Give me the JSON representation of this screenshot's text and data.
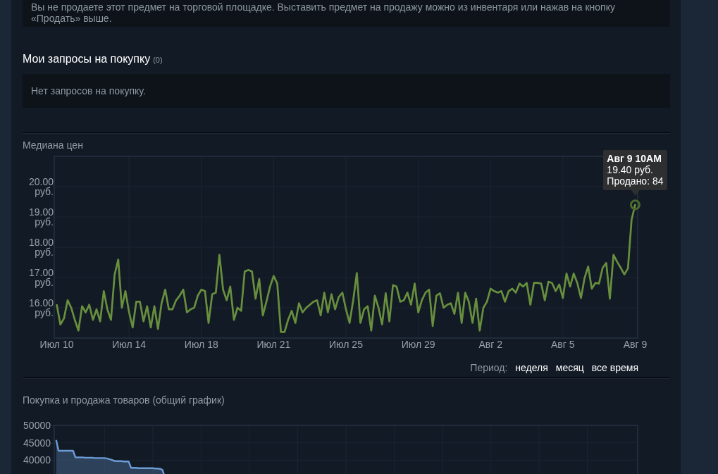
{
  "notice": {
    "text": "Вы не продаете этот предмет на торговой площадке. Выставить предмет на продажу можно из инвентаря или нажав на кнопку «Продать» выше."
  },
  "buy_orders": {
    "title": "Мои запросы на покупку",
    "count": "(0)",
    "empty_text": "Нет запросов на покупку."
  },
  "price_history": {
    "title": "Медиана цен",
    "chart_data": {
      "type": "line",
      "grid": true,
      "ylim": [
        15,
        21
      ],
      "yticks": [
        {
          "value": 20,
          "label": "20.00 руб."
        },
        {
          "value": 19,
          "label": "19.00 руб."
        },
        {
          "value": 18,
          "label": "18.00 руб."
        },
        {
          "value": 17,
          "label": "17.00 руб."
        },
        {
          "value": 16,
          "label": "16.00 руб."
        }
      ],
      "categories": [
        "Июл 10",
        null,
        null,
        null,
        null,
        null,
        null,
        null,
        null,
        null,
        null,
        null,
        null,
        null,
        null,
        null,
        null,
        null,
        null,
        null,
        "Июл 14",
        null,
        null,
        null,
        null,
        null,
        null,
        null,
        null,
        null,
        null,
        null,
        null,
        null,
        null,
        null,
        null,
        null,
        null,
        null,
        "Июл 18",
        null,
        null,
        null,
        null,
        null,
        null,
        null,
        null,
        null,
        null,
        null,
        null,
        null,
        null,
        null,
        null,
        null,
        null,
        null,
        "Июл 21",
        null,
        null,
        null,
        null,
        null,
        null,
        null,
        null,
        null,
        null,
        null,
        null,
        null,
        null,
        null,
        null,
        null,
        null,
        null,
        "Июл 25",
        null,
        null,
        null,
        null,
        null,
        null,
        null,
        null,
        null,
        null,
        null,
        null,
        null,
        null,
        null,
        null,
        null,
        null,
        null,
        "Июл 29",
        null,
        null,
        null,
        null,
        null,
        null,
        null,
        null,
        null,
        null,
        null,
        null,
        null,
        null,
        null,
        null,
        null,
        null,
        null,
        "Авг 2",
        null,
        null,
        null,
        null,
        null,
        null,
        null,
        null,
        null,
        null,
        null,
        null,
        null,
        null,
        null,
        null,
        null,
        null,
        null,
        "Авг 5",
        null,
        null,
        null,
        null,
        null,
        null,
        null,
        null,
        null,
        null,
        null,
        null,
        null,
        null,
        null,
        null,
        null,
        null,
        null,
        "Авг 9"
      ],
      "series": [
        {
          "color": "#688f3e",
          "values": [
            16.09,
            15.45,
            15.65,
            16.25,
            16.0,
            15.6,
            15.25,
            16.05,
            15.85,
            16.1,
            15.6,
            15.95,
            15.55,
            16.55,
            15.95,
            15.6,
            17.1,
            17.59,
            16.0,
            16.55,
            15.85,
            15.35,
            16.2,
            16.2,
            15.55,
            16.05,
            15.35,
            16.05,
            15.3,
            16.15,
            16.6,
            15.95,
            15.95,
            16.25,
            16.4,
            16.6,
            15.85,
            15.95,
            16.0,
            16.4,
            16.6,
            16.55,
            15.5,
            16.45,
            16.5,
            17.75,
            16.6,
            16.25,
            16.7,
            15.6,
            16.0,
            15.9,
            17.2,
            17.25,
            17.2,
            16.3,
            16.95,
            15.75,
            16.2,
            16.7,
            17.05,
            16.8,
            15.2,
            15.2,
            15.6,
            15.9,
            15.5,
            16.15,
            15.85,
            16.0,
            16.1,
            16.2,
            16.25,
            15.75,
            16.5,
            15.85,
            16.45,
            15.95,
            16.35,
            16.5,
            15.95,
            15.5,
            16.25,
            17.15,
            15.5,
            15.95,
            16.05,
            15.25,
            16.4,
            16.0,
            15.45,
            16.48,
            15.55,
            16.75,
            16.7,
            16.2,
            16.25,
            16.5,
            16.1,
            16.8,
            15.85,
            16.25,
            16.5,
            16.6,
            15.4,
            16.4,
            16.48,
            16.0,
            16.1,
            16.15,
            15.8,
            16.5,
            15.5,
            16.5,
            16.2,
            15.5,
            16.3,
            15.25,
            16.0,
            16.2,
            16.63,
            16.55,
            16.5,
            16.55,
            16.2,
            16.55,
            16.63,
            16.5,
            16.8,
            16.7,
            16.82,
            16.1,
            16.82,
            16.82,
            16.8,
            16.25,
            16.86,
            16.82,
            16.55,
            16.77,
            16.32,
            17.13,
            16.7,
            17.13,
            16.82,
            16.32,
            16.98,
            17.36,
            16.63,
            16.82,
            16.8,
            17.32,
            17.48,
            16.3,
            17.75,
            17.52,
            17.32,
            17.1,
            17.3,
            18.9,
            19.4
          ]
        }
      ]
    },
    "tooltip": {
      "date": "Авг 9 10AM",
      "price": "19.40 руб.",
      "sold": "Продано: 84"
    },
    "period": {
      "label": "Период:",
      "options": [
        "неделя",
        "месяц",
        "все время"
      ]
    }
  },
  "volume_chart": {
    "title": "Покупка и продажа товаров (общий график)",
    "chart_data": {
      "type": "area",
      "grid": true,
      "ylim": [
        35000,
        50000
      ],
      "yticks": [
        {
          "value": 50000,
          "label": "50000"
        },
        {
          "value": 45000,
          "label": "45000"
        },
        {
          "value": 40000,
          "label": "40000"
        }
      ],
      "categories": [
        null,
        null,
        null,
        null,
        null,
        null,
        null,
        null,
        null,
        null,
        null,
        null,
        null,
        null,
        null,
        null,
        null,
        null,
        null,
        null,
        null,
        null,
        null,
        null,
        null,
        null,
        null,
        null,
        null,
        null,
        null,
        null,
        null,
        null,
        null,
        null,
        null,
        null,
        null,
        null,
        null,
        null,
        null,
        null,
        null,
        null,
        null,
        null,
        null,
        null,
        null,
        null,
        null,
        null,
        null,
        null,
        null,
        null,
        null,
        null,
        null,
        null,
        null,
        null,
        null,
        null,
        null,
        null,
        null,
        null,
        null,
        null,
        null,
        null,
        null,
        null,
        null,
        null,
        null,
        null,
        null,
        null,
        null,
        null,
        null,
        null,
        null,
        null,
        null,
        null,
        null,
        null,
        null,
        null,
        null,
        null,
        null,
        null,
        null,
        null,
        null,
        null,
        null,
        null,
        null,
        null,
        null,
        null,
        null,
        null,
        null,
        null,
        null,
        null,
        null,
        null,
        null,
        null,
        null,
        null,
        null,
        null,
        null,
        null,
        null,
        null,
        null,
        null,
        null,
        null,
        null,
        null,
        null,
        null,
        null,
        null,
        null,
        null,
        null,
        null,
        null,
        null,
        null,
        null,
        null,
        null,
        null,
        null,
        null,
        null,
        null,
        null,
        null,
        null,
        null,
        null,
        null,
        null,
        null,
        null,
        null,
        null,
        null,
        null,
        null,
        null,
        null,
        null,
        null,
        null,
        null,
        null,
        null,
        null,
        null,
        null,
        null,
        null,
        null,
        null,
        null,
        null,
        null,
        null,
        null,
        null,
        null,
        null,
        null,
        null,
        null,
        null,
        null,
        null,
        null,
        null,
        null,
        null,
        null,
        null,
        null,
        null,
        null,
        null,
        null,
        null,
        null,
        null,
        null,
        null,
        null,
        null,
        null,
        null,
        null,
        null,
        null,
        null,
        null,
        null,
        null,
        null,
        null,
        null,
        null,
        null,
        null,
        null,
        null,
        null,
        null,
        null,
        null,
        null,
        null,
        null,
        null,
        null,
        null,
        null,
        null
      ],
      "series": [
        {
          "color": "#6c9bd6",
          "values": [
            45800,
            42700,
            42700,
            42700,
            42700,
            42700,
            42700,
            42700,
            40800,
            40800,
            40800,
            40800,
            40700,
            40700,
            40700,
            40700,
            40600,
            40600,
            40600,
            40600,
            40600,
            40500,
            40300,
            40100,
            39800,
            39700,
            39700,
            39700,
            39600,
            39600,
            39600,
            37800,
            37800,
            37800,
            37700,
            37700,
            37700,
            37700,
            37700,
            37700,
            37700,
            37600,
            37600,
            37500,
            37200,
            35200,
            null,
            null,
            null,
            null,
            null,
            null,
            null,
            null,
            null,
            null,
            null,
            null,
            null,
            null,
            null,
            null,
            null,
            null,
            null,
            null,
            null,
            null,
            null,
            null,
            null,
            null,
            null,
            null,
            null,
            null,
            null,
            null,
            null,
            null,
            null,
            null,
            null,
            null,
            null,
            null,
            null,
            null,
            null,
            null,
            null,
            null,
            null,
            null,
            null,
            null,
            null,
            null,
            null,
            null,
            null,
            null,
            null,
            null,
            null,
            null,
            null,
            null,
            null,
            null,
            null,
            null,
            null,
            null,
            null,
            null,
            null,
            null,
            null,
            null,
            null,
            null,
            null,
            null,
            null,
            null,
            null,
            null,
            null,
            null,
            null,
            null,
            null,
            null,
            null,
            null,
            null,
            null,
            null,
            null,
            null,
            null,
            null,
            null,
            null,
            null,
            null,
            null,
            null,
            null,
            null,
            null,
            null,
            null,
            null,
            null,
            null,
            null,
            null,
            null,
            null,
            null,
            null,
            null,
            null,
            null,
            null,
            null,
            null,
            null,
            null,
            null,
            null,
            null,
            null,
            null,
            null,
            null,
            null,
            null,
            null,
            null,
            null,
            null,
            null,
            null,
            null,
            null,
            null,
            null,
            null,
            null,
            null,
            null,
            null,
            null,
            null,
            null,
            null,
            null,
            null,
            null,
            null,
            null,
            null,
            null,
            null,
            null,
            null,
            null,
            null,
            null,
            null,
            null,
            null,
            null,
            null,
            null,
            null,
            null,
            null,
            null,
            null,
            null,
            null,
            null,
            null,
            null,
            null,
            null,
            null,
            null,
            null,
            null,
            null,
            null,
            null,
            null,
            null,
            null,
            null
          ]
        }
      ]
    }
  }
}
